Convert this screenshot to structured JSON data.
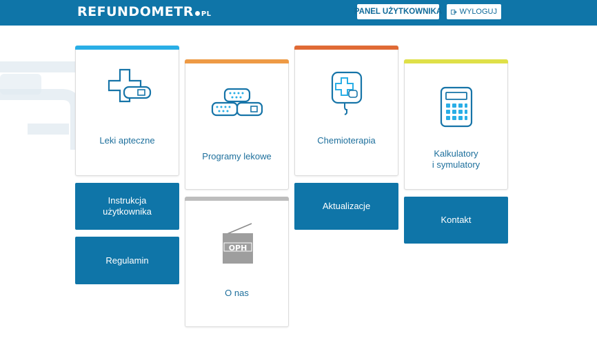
{
  "header": {
    "logo_text": "REFUNDOMETR",
    "logo_tld": "PL",
    "panel_label": "PANEL UŻYTKOWNIKA",
    "logout_label": "WYLOGUJ"
  },
  "colors": {
    "header": "#0f75a8",
    "accent_blue": "#29aee6",
    "accent_orange": "#ee9a45",
    "accent_red": "#e06a35",
    "accent_yellow": "#dfe048",
    "accent_gray": "#bdbdbd",
    "button_blue": "#0f75a8"
  },
  "tiles": [
    {
      "label": "Leki apteczne",
      "icon": "cross-pill-icon"
    },
    {
      "label": "Programy lekowe",
      "icon": "pills-icon"
    },
    {
      "label": "Chemioterapia",
      "icon": "iv-drip-icon"
    },
    {
      "label_line1": "Kalkulatory",
      "label_line2": "i symulatory",
      "icon": "calculator-icon"
    },
    {
      "label": "O nas",
      "icon": "oph-logo"
    }
  ],
  "oph_text": "OPH",
  "buttons": {
    "instrukcja_line1": "Instrukcja",
    "instrukcja_line2": "użytkownika",
    "regulamin": "Regulamin",
    "aktualizacje": "Aktualizacje",
    "kontakt": "Kontakt"
  }
}
